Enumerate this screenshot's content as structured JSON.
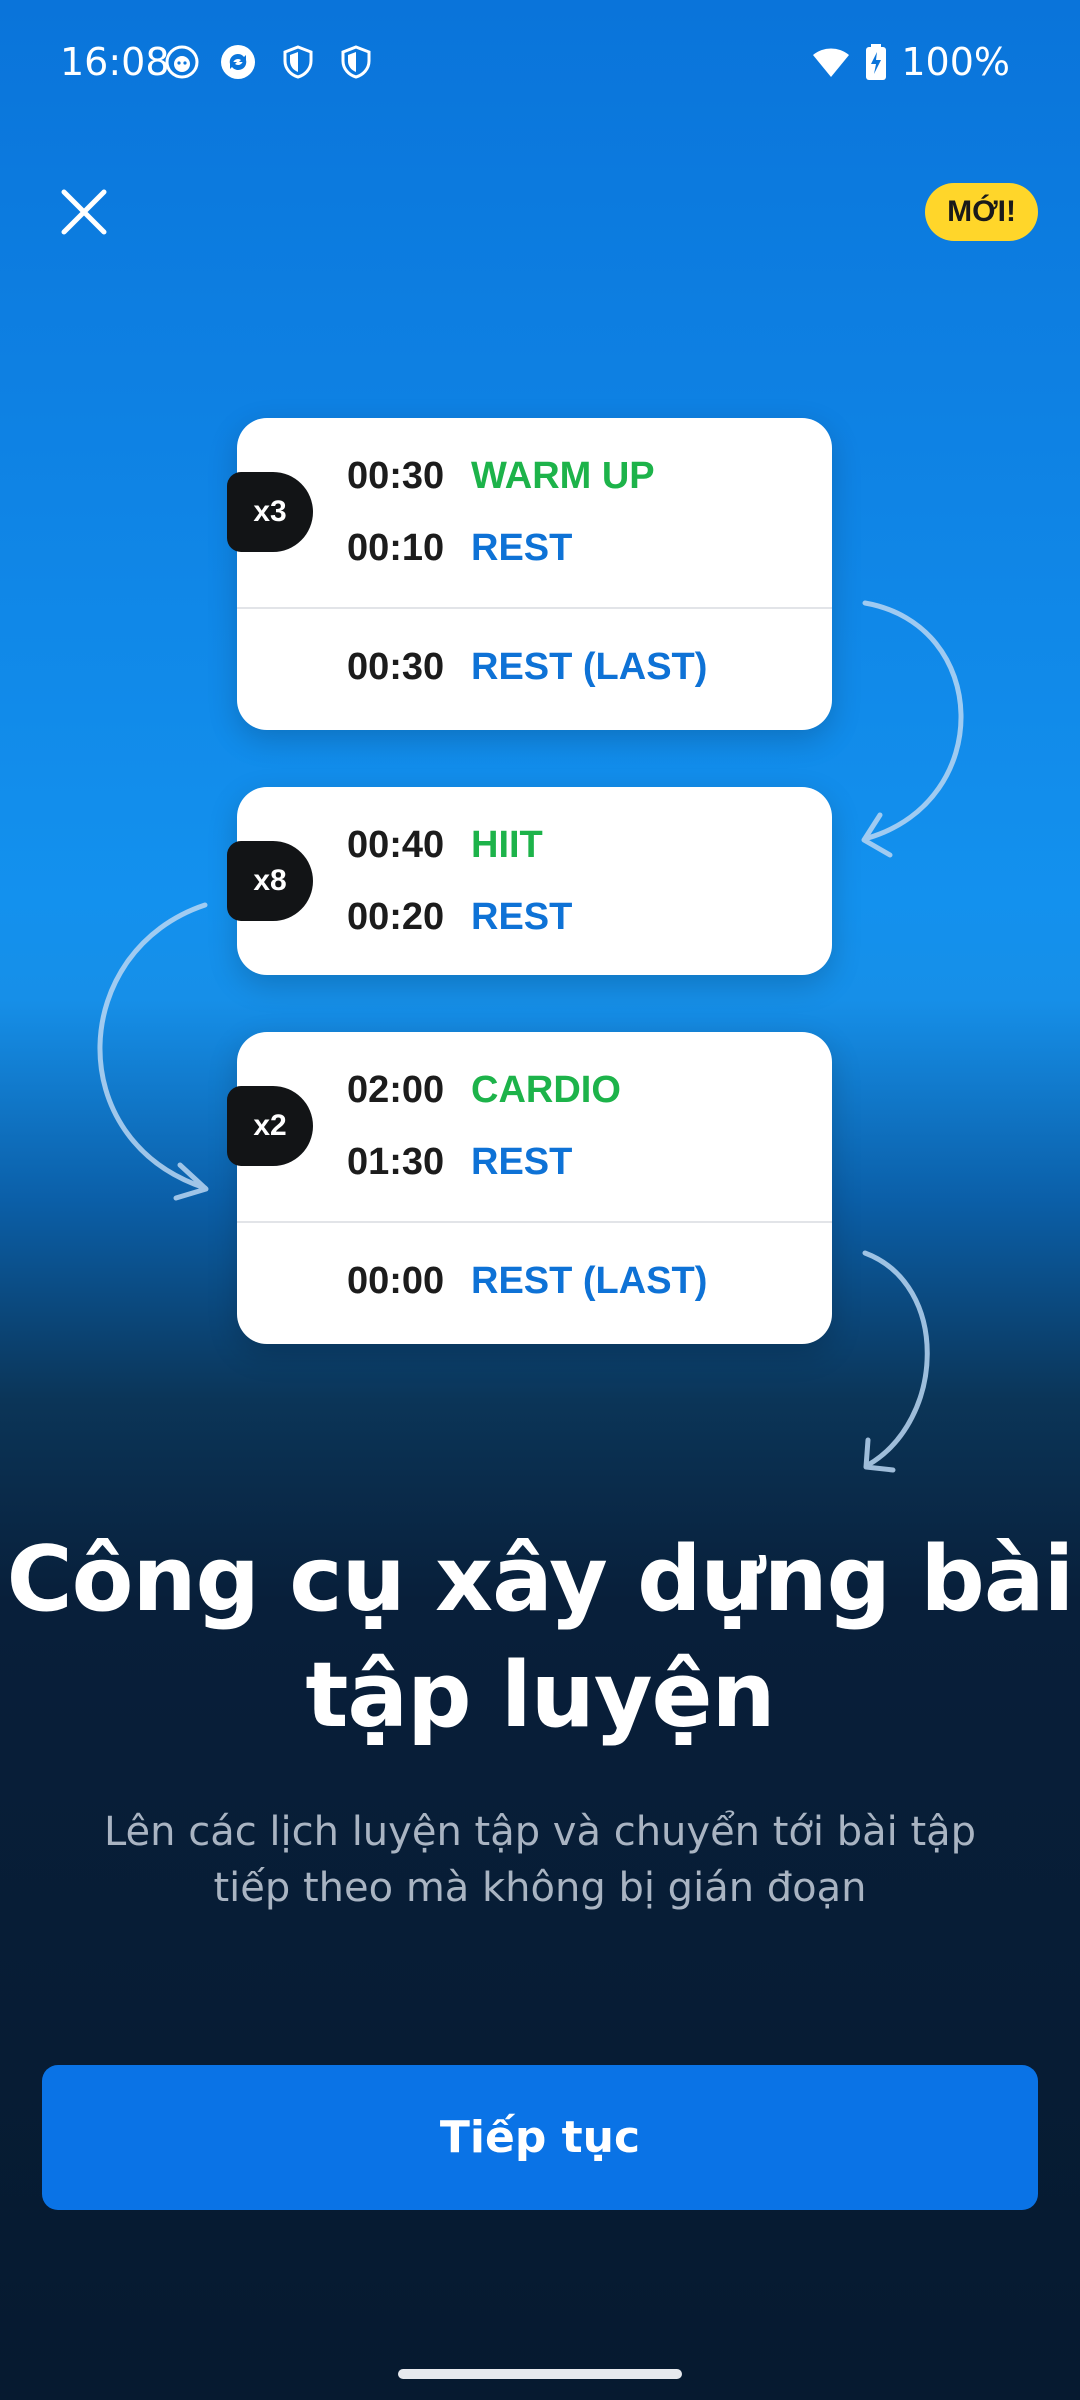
{
  "status_bar": {
    "time": "16:08",
    "battery": "100%",
    "icons": [
      "notification-face-icon",
      "sync-icon",
      "shield-icon",
      "shield-icon",
      "wifi-icon",
      "battery-charging-icon"
    ]
  },
  "header": {
    "close_icon": "close-icon",
    "badge": "MỚI!"
  },
  "cards": [
    {
      "repeat": "x3",
      "rows": [
        {
          "time": "00:30",
          "label": "WARM UP",
          "color": "#1db34a"
        },
        {
          "time": "00:10",
          "label": "REST",
          "color": "#0e72d6"
        }
      ],
      "last": {
        "time": "00:30",
        "label": "REST (LAST)",
        "color": "#0e72d6"
      }
    },
    {
      "repeat": "x8",
      "rows": [
        {
          "time": "00:40",
          "label": "HIIT",
          "color": "#1db34a"
        },
        {
          "time": "00:20",
          "label": "REST",
          "color": "#0e72d6"
        }
      ]
    },
    {
      "repeat": "x2",
      "rows": [
        {
          "time": "02:00",
          "label": "CARDIO",
          "color": "#1db34a"
        },
        {
          "time": "01:30",
          "label": "REST",
          "color": "#0e72d6"
        }
      ],
      "last": {
        "time": "00:00",
        "label": "REST (LAST)",
        "color": "#0e72d6"
      }
    }
  ],
  "content": {
    "title": "Công cụ xây dựng bài tập luyện",
    "subtitle": "Lên các lịch luyện tập và chuyển tới bài tập tiếp theo mà không bị gián đoạn"
  },
  "cta": {
    "label": "Tiếp tục"
  },
  "colors": {
    "accent": "#0a73e6",
    "badge": "#ffd62a",
    "green": "#1db34a",
    "blue": "#0e72d6"
  }
}
